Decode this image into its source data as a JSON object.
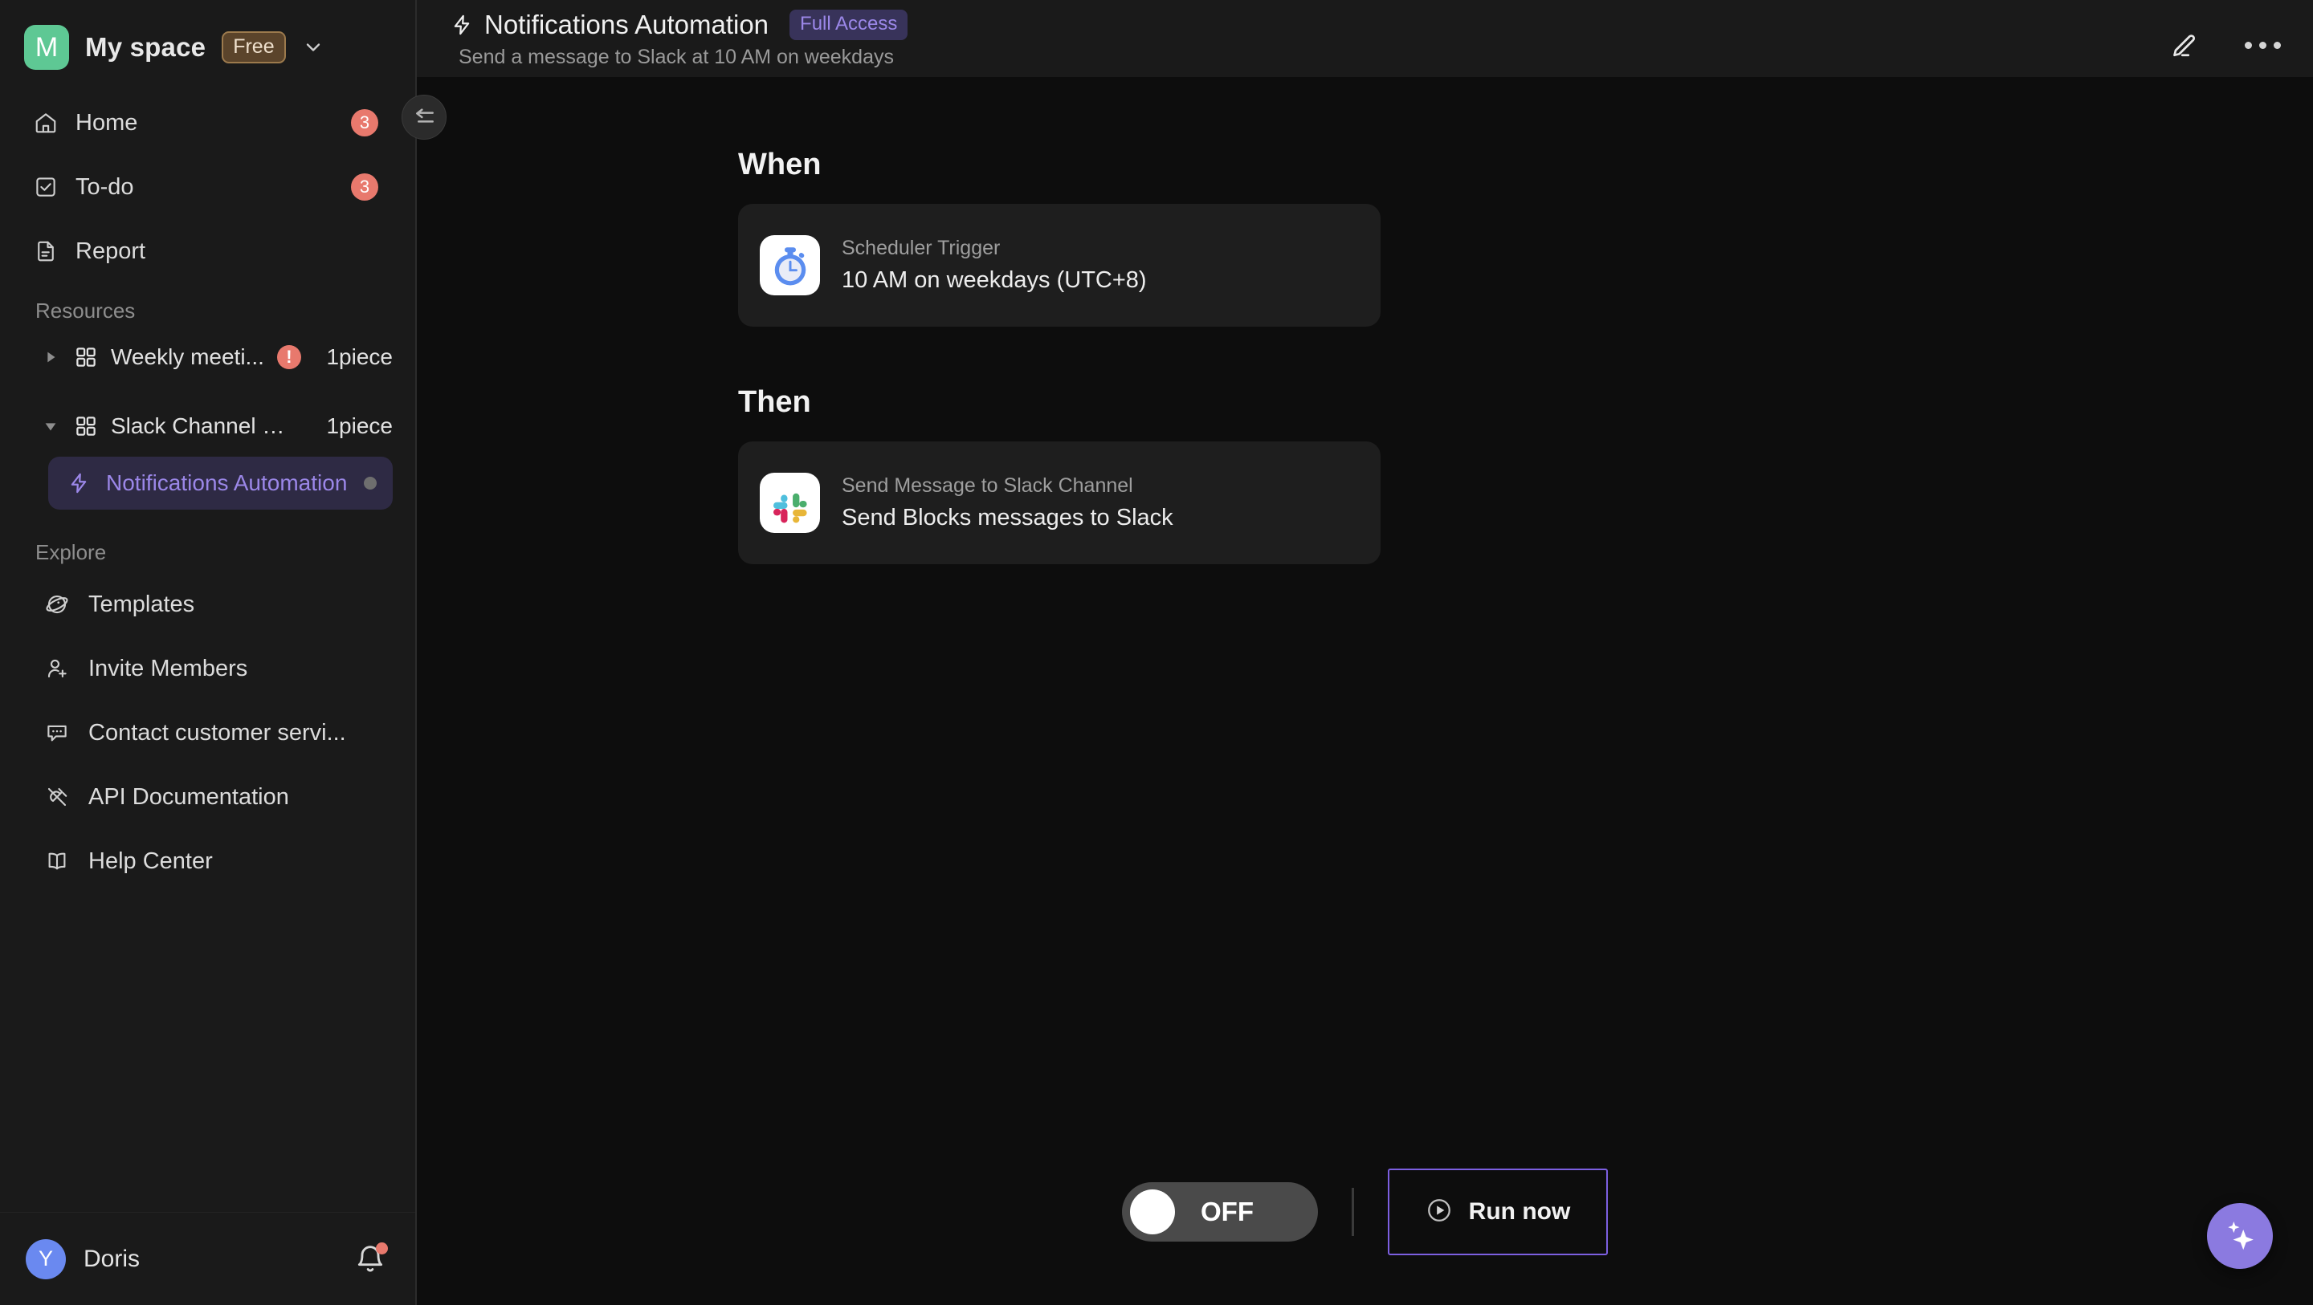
{
  "sidebar": {
    "space": {
      "initial": "M",
      "name": "My space",
      "plan_badge": "Free"
    },
    "nav": [
      {
        "label": "Home",
        "icon": "home-icon",
        "badge": "3"
      },
      {
        "label": "To-do",
        "icon": "checkbox-icon",
        "badge": "3"
      },
      {
        "label": "Report",
        "icon": "document-icon",
        "badge": ""
      }
    ],
    "resources_label": "Resources",
    "resources": [
      {
        "label": "Weekly meeti...",
        "count": "1piece",
        "expanded": false,
        "warning": "!"
      },
      {
        "label": "Slack Channel Sc...",
        "count": "1piece",
        "expanded": true,
        "warning": ""
      }
    ],
    "resource_child": {
      "label": "Notifications Automation",
      "icon": "bolt-icon"
    },
    "explore_label": "Explore",
    "explore": [
      {
        "label": "Templates",
        "icon": "planet-icon"
      },
      {
        "label": "Invite Members",
        "icon": "user-plus-icon"
      },
      {
        "label": "Contact customer servi...",
        "icon": "chat-icon"
      },
      {
        "label": "API Documentation",
        "icon": "plug-icon"
      },
      {
        "label": "Help Center",
        "icon": "book-icon"
      }
    ],
    "footer": {
      "avatar_initial": "Y",
      "user_name": "Doris"
    }
  },
  "header": {
    "title": "Notifications Automation",
    "access_badge": "Full Access",
    "subtitle": "Send a message to Slack at 10 AM on weekdays"
  },
  "flow": {
    "when_heading": "When",
    "when_node": {
      "subtitle": "Scheduler Trigger",
      "title": "10 AM on weekdays (UTC+8)",
      "icon": "stopwatch-icon"
    },
    "then_heading": "Then",
    "then_node": {
      "subtitle": "Send Message to Slack Channel",
      "title": "Send Blocks messages to Slack",
      "icon": "slack-icon"
    }
  },
  "controls": {
    "toggle_state": "OFF",
    "run_label": "Run now"
  },
  "colors": {
    "accent_purple": "#7c5fe0",
    "badge_red": "#e8796d",
    "space_green": "#5ec894",
    "avatar_blue": "#6a89f0"
  }
}
